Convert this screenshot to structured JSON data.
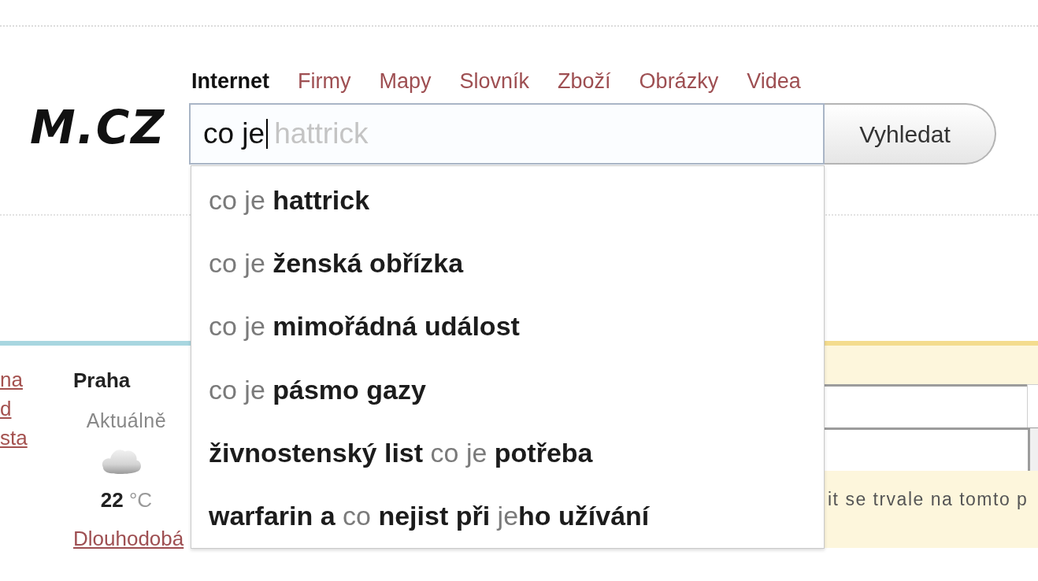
{
  "logo": {
    "text": "M.CZ"
  },
  "tabs": [
    {
      "label": "Internet",
      "selected": true
    },
    {
      "label": "Firmy",
      "selected": false
    },
    {
      "label": "Mapy",
      "selected": false
    },
    {
      "label": "Slovník",
      "selected": false
    },
    {
      "label": "Zboží",
      "selected": false
    },
    {
      "label": "Obrázky",
      "selected": false
    },
    {
      "label": "Videa",
      "selected": false
    }
  ],
  "search": {
    "value": "co je",
    "completion_hint": "hattrick",
    "button": "Vyhledat"
  },
  "suggestions": [
    {
      "text": "co je **hattrick**",
      "selected": false
    },
    {
      "text": "co je **ženská obřízka**",
      "selected": false
    },
    {
      "text": "co je **mimořádná událost**",
      "selected": false
    },
    {
      "text": "co je **pásmo gazy**",
      "selected": false
    },
    {
      "text": "**živnostenský list** co je **potřeba**",
      "selected": false
    },
    {
      "text": "**warfarin a** co **nejist při** je**ho užívání**",
      "selected": false
    }
  ],
  "left_links": [
    "na",
    "d",
    "sta"
  ],
  "weather": {
    "city": "Praha",
    "label": "Aktuálně",
    "temperature": "**22** °C",
    "link": "Dlouhodobá"
  },
  "notice": {
    "text": "it se trvale na tomto p"
  }
}
